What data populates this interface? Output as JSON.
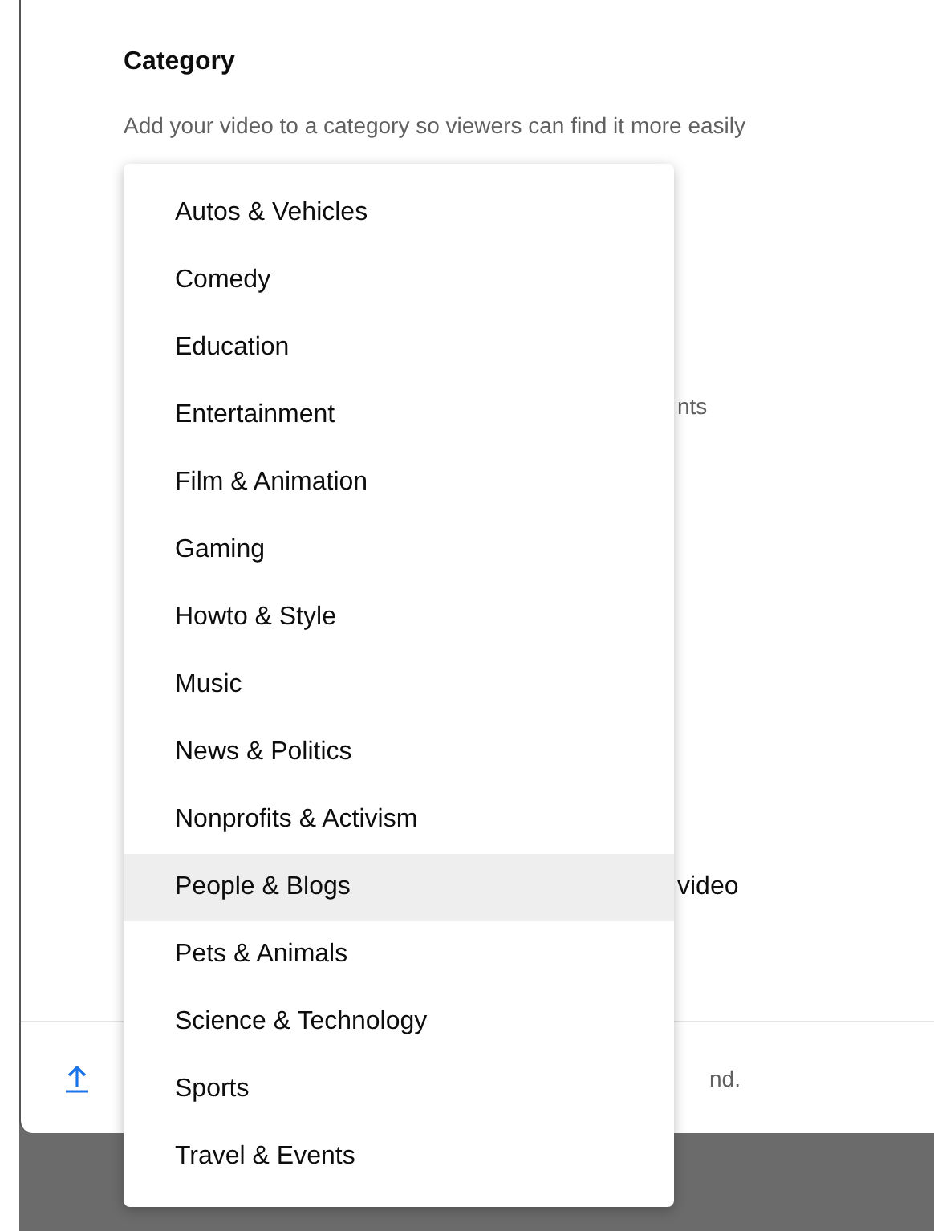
{
  "section": {
    "title": "Category",
    "description": "Add your video to a category so viewers can find it more easily"
  },
  "background_fragments": [
    "nts",
    "video"
  ],
  "footer": {
    "text": "nd."
  },
  "menu": {
    "items": [
      {
        "label": "Autos & Vehicles",
        "selected": false
      },
      {
        "label": "Comedy",
        "selected": false
      },
      {
        "label": "Education",
        "selected": false
      },
      {
        "label": "Entertainment",
        "selected": false
      },
      {
        "label": "Film & Animation",
        "selected": false
      },
      {
        "label": "Gaming",
        "selected": false
      },
      {
        "label": "Howto & Style",
        "selected": false
      },
      {
        "label": "Music",
        "selected": false
      },
      {
        "label": "News & Politics",
        "selected": false
      },
      {
        "label": "Nonprofits & Activism",
        "selected": false
      },
      {
        "label": "People & Blogs",
        "selected": true
      },
      {
        "label": "Pets & Animals",
        "selected": false
      },
      {
        "label": "Science & Technology",
        "selected": false
      },
      {
        "label": "Sports",
        "selected": false
      },
      {
        "label": "Travel & Events",
        "selected": false
      }
    ]
  }
}
